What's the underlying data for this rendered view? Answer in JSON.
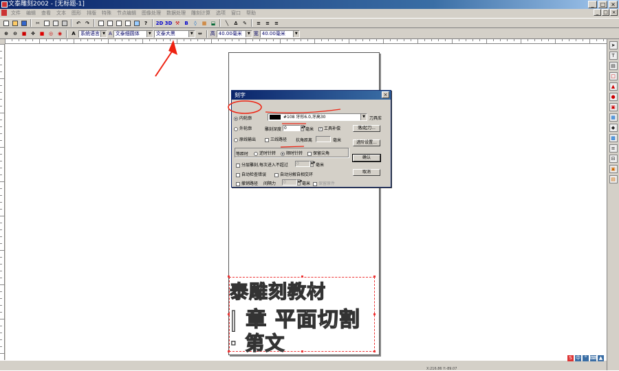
{
  "window": {
    "title": "文泰雕刻2002 - [无标题-1]",
    "min": "_",
    "max": "□",
    "close": "×"
  },
  "menu": [
    "文件",
    "编辑",
    "查看",
    "文本",
    "图形",
    "排版",
    "特殊",
    "节点编辑",
    "图像处理",
    "数据处理",
    "雕刻计算",
    "选项",
    "窗口",
    "帮助"
  ],
  "toolbar": {
    "tb_2d": "2D",
    "tb_3d": "3D",
    "tb_b": "B",
    "font_language": "系统语言",
    "font_name": "文泰细圆体",
    "font_style": "文泰大黑",
    "width_label": "高",
    "width_value": "40.00毫米",
    "height_label": "宽",
    "height_value": "40.00毫米"
  },
  "canvas_text": {
    "line1": "泰雕刻教材",
    "line2": "| 章  平面切割",
    "line3": "· 第文"
  },
  "dialog": {
    "title": "刻字",
    "close": "×",
    "inner_contour": "内轮廓",
    "outer_contour": "外轮廓",
    "original_output": "原线输出",
    "tool_value": "#108  牙形6.0,牙高30",
    "tool_library_button": "刀具库",
    "engrave_width_label": "雕刻深度",
    "engrave_width_value": "0",
    "mm": "毫米",
    "tool_compensation": "工具补偿",
    "retract_button": "落/起刀...",
    "three_line_path": "三线路径",
    "offset_distance_label": "抗角距离",
    "offset_value": "",
    "advanced_settings": "进阶设置...",
    "direction_label": "等距时",
    "counter_clockwise": "逆时针转",
    "clockwise": "顺时针转",
    "keep_sharp_corner": "保留尖角",
    "ok_button": "确认",
    "layered_engrave": "分层雕刻,每次进入不超过",
    "layered_value": "0",
    "cancel_button": "取消",
    "auto_check_intersect": "自动检查错误",
    "auto_decompose": "自动分解自相交环",
    "smooth_path": "撤销路径",
    "gap_label": "间隔力",
    "gap_value": "0",
    "keep_origin": "保留原件"
  },
  "status": {
    "coords": "X:216.86 Y:-89.07"
  }
}
